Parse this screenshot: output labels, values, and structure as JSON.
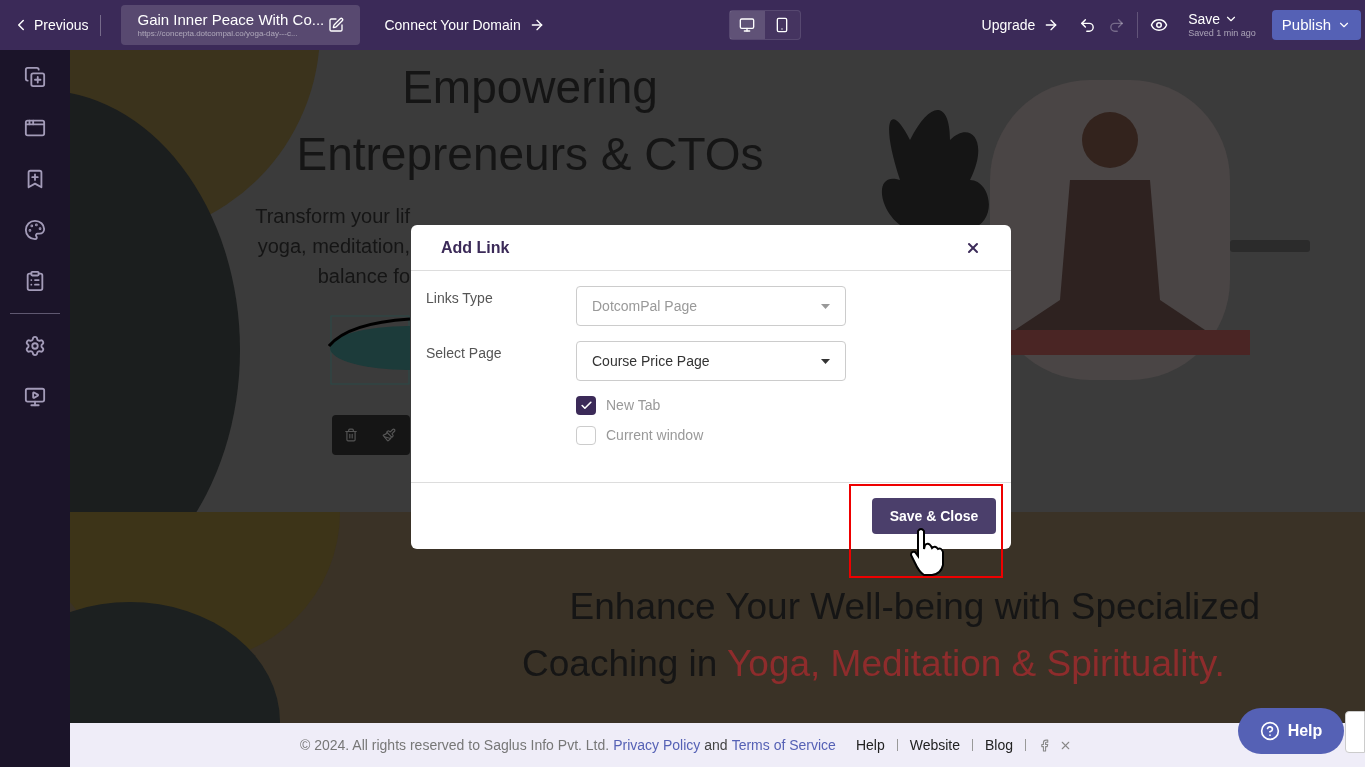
{
  "topbar": {
    "previous": "Previous",
    "page_title": "Gain Inner Peace With Co...",
    "page_url": "https://concepta.dotcompal.co/yoga-day---c...",
    "connect_domain": "Connect Your Domain",
    "devices": [
      {
        "kind": "desktop",
        "selected": true
      },
      {
        "kind": "mobile",
        "selected": false
      }
    ],
    "upgrade": "Upgrade",
    "undo": {
      "disabled": false
    },
    "redo": {
      "disabled": true
    },
    "save": "Save",
    "save_status": "Saved 1 min ago",
    "publish": "Publish"
  },
  "canvas": {
    "hero_lines": [
      "Empowering",
      "Entrepreneurs & CTOs"
    ],
    "partial_lines": [
      "Transform your lif",
      "yoga, meditation,",
      "balance fo"
    ],
    "section_heading": {
      "line_1": "Enhance Your Well-being with Specialized",
      "line_2_start": "Coaching in ",
      "line_2_highlight": "Yoga, Meditation & Spirituality."
    }
  },
  "modal": {
    "title": "Add Link",
    "fields": [
      {
        "label": "Links Type",
        "value": "DotcomPal Page",
        "disabled": true
      },
      {
        "label": "Select Page",
        "value": "Course Price Page",
        "disabled": false
      }
    ],
    "options": [
      {
        "label": "New Tab",
        "checked": true
      },
      {
        "label": "Current window",
        "checked": false
      }
    ],
    "submit": "Save & Close"
  },
  "footer": {
    "copyright": "©  2024. All rights reserved to Saglus Info Pvt. Ltd.",
    "privacy": "Privacy Policy",
    "and": "and",
    "terms": "Terms of Service",
    "links": [
      "Help",
      "Website",
      "Blog"
    ]
  },
  "help_button": "Help"
}
